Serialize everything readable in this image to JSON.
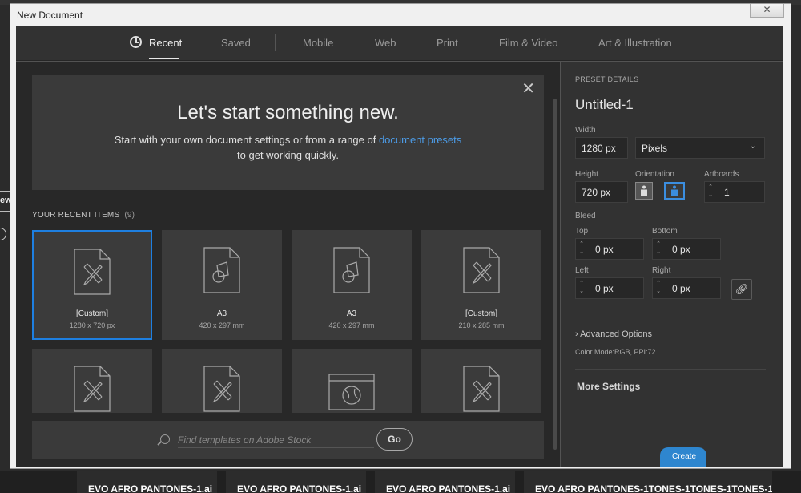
{
  "window": {
    "title": "New Document",
    "close_glyph": "✕"
  },
  "tabs": [
    {
      "label": "Recent",
      "active": true
    },
    {
      "label": "Saved",
      "active": false
    },
    {
      "label": "Mobile",
      "active": false
    },
    {
      "label": "Web",
      "active": false
    },
    {
      "label": "Print",
      "active": false
    },
    {
      "label": "Film & Video",
      "active": false
    },
    {
      "label": "Art & Illustration",
      "active": false
    }
  ],
  "hero": {
    "title": "Let's start something new.",
    "subtitle_before": "Start with your own document settings or from a range of ",
    "subtitle_link": "document presets",
    "subtitle_after": "to get working quickly.",
    "close_glyph": "✕"
  },
  "recent": {
    "heading": "YOUR RECENT ITEMS",
    "count": "(9)",
    "items": [
      {
        "name": "[Custom]",
        "size": "1280 x 720 px",
        "icon": "pencil-doc-icon",
        "selected": true
      },
      {
        "name": "A3",
        "size": "420 x 297 mm",
        "icon": "shapes-doc-icon",
        "selected": false
      },
      {
        "name": "A3",
        "size": "420 x 297 mm",
        "icon": "shapes-doc-icon",
        "selected": false
      },
      {
        "name": "[Custom]",
        "size": "210 x 285 mm",
        "icon": "pencil-doc-icon",
        "selected": false
      },
      {
        "icon": "pencil-doc-icon"
      },
      {
        "icon": "pencil-doc-icon"
      },
      {
        "icon": "web-globe-icon"
      },
      {
        "icon": "pencil-doc-icon"
      }
    ]
  },
  "search": {
    "placeholder": "Find templates on Adobe Stock",
    "go_label": "Go"
  },
  "preset": {
    "section_title": "PRESET DETAILS",
    "name": "Untitled-1",
    "width_label": "Width",
    "width_value": "1280 px",
    "units_value": "Pixels",
    "height_label": "Height",
    "height_value": "720 px",
    "orientation_label": "Orientation",
    "artboards_label": "Artboards",
    "artboards_value": "1",
    "bleed_label": "Bleed",
    "top_label": "Top",
    "top_value": "0 px",
    "bottom_label": "Bottom",
    "bottom_value": "0 px",
    "left_label": "Left",
    "left_value": "0 px",
    "right_label": "Right",
    "right_value": "0 px",
    "advanced_label": "Advanced Options",
    "color_mode": "Color Mode:RGB, PPI:72",
    "more_settings": "More Settings",
    "create_label": "Create"
  },
  "background_tabs": [
    "EVO AFRO PANTONES-1.ai",
    "EVO AFRO PANTONES-1.ai",
    "EVO AFRO PANTONES-1.ai",
    "EVO AFRO PANTONES-1TONES-1TONES-1TONES-1"
  ],
  "background_edge_text": "ew",
  "colors": {
    "accent": "#1e7fe0",
    "link": "#4c9ce8",
    "dialog_bg": "#282828",
    "panel_bg": "#323232"
  }
}
